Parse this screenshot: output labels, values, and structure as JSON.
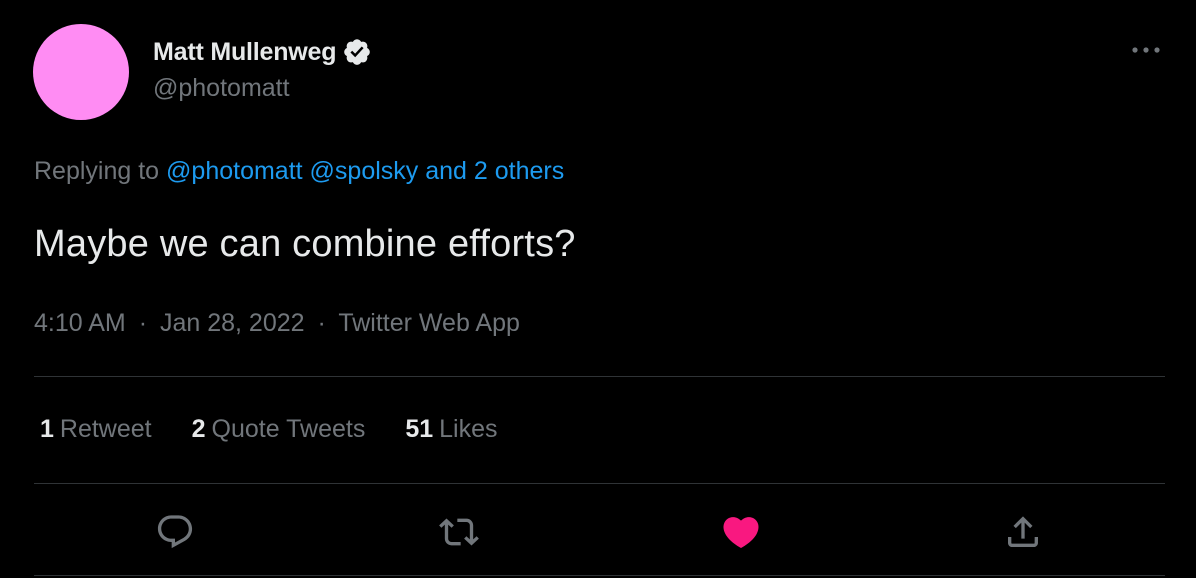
{
  "author": {
    "display_name": "Matt Mullenweg",
    "handle": "@photomatt",
    "avatar_color": "#ff8cf3",
    "verified_icon": "verified-badge-icon"
  },
  "reply_context": {
    "prefix": "Replying to",
    "mentions": [
      "@photomatt",
      "@spolsky",
      "and 2 others"
    ]
  },
  "tweet": {
    "text": "Maybe we can combine efforts?"
  },
  "meta": {
    "time": "4:10 AM",
    "separator": "·",
    "date": "Jan 28, 2022",
    "source": "Twitter Web App"
  },
  "stats": [
    {
      "count": "1",
      "label": "Retweet"
    },
    {
      "count": "2",
      "label": "Quote Tweets"
    },
    {
      "count": "51",
      "label": "Likes"
    }
  ],
  "actions": [
    {
      "icon": "reply-icon"
    },
    {
      "icon": "retweet-icon"
    },
    {
      "icon": "like-heart-icon",
      "active": true
    },
    {
      "icon": "share-icon"
    }
  ],
  "colors": {
    "background": "#000000",
    "primary_text": "#e7e9ea",
    "secondary_text": "#71767b",
    "link": "#1d9bf0",
    "like_active": "#f91880",
    "divider": "#2f3336"
  }
}
